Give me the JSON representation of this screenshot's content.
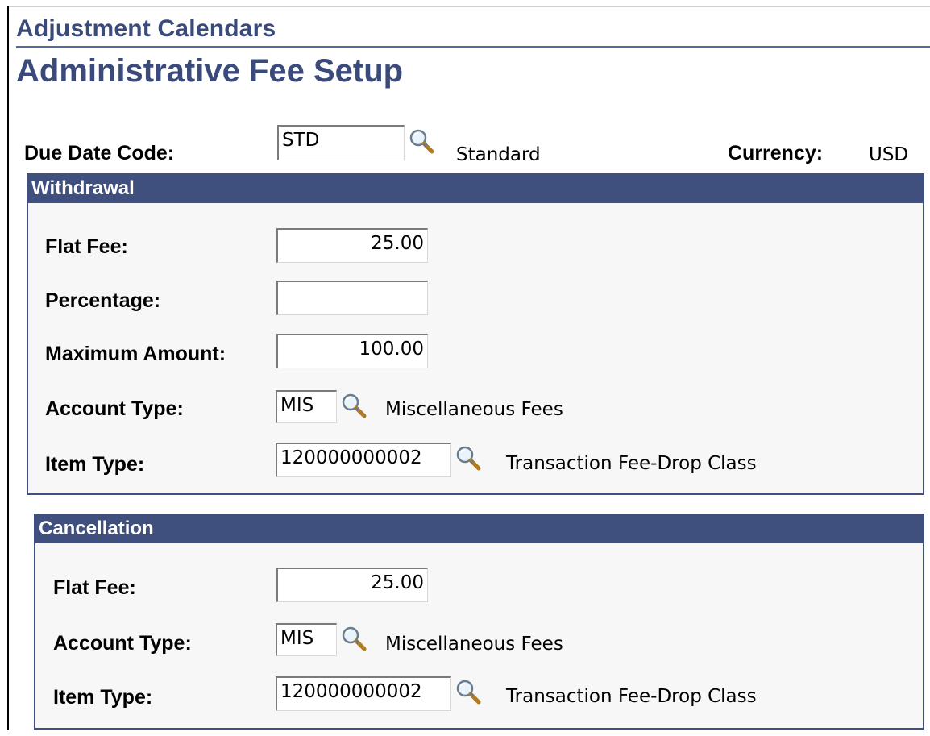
{
  "breadcrumb": "Adjustment Calendars",
  "page_title": "Administrative Fee Setup",
  "header": {
    "due_date_code_label": "Due Date Code:",
    "due_date_code_value": "STD",
    "due_date_code_desc": "Standard",
    "currency_label": "Currency:",
    "currency_value": "USD"
  },
  "withdrawal": {
    "title": "Withdrawal",
    "flat_fee_label": "Flat Fee:",
    "flat_fee_value": "25.00",
    "percentage_label": "Percentage:",
    "percentage_value": "",
    "max_amount_label": "Maximum Amount:",
    "max_amount_value": "100.00",
    "account_type_label": "Account Type:",
    "account_type_value": "MIS",
    "account_type_desc": "Miscellaneous Fees",
    "item_type_label": "Item Type:",
    "item_type_value": "120000000002",
    "item_type_desc": "Transaction Fee-Drop Class"
  },
  "cancellation": {
    "title": "Cancellation",
    "flat_fee_label": "Flat Fee:",
    "flat_fee_value": "25.00",
    "account_type_label": "Account Type:",
    "account_type_value": "MIS",
    "account_type_desc": "Miscellaneous Fees",
    "item_type_label": "Item Type:",
    "item_type_value": "120000000002",
    "item_type_desc": "Transaction Fee-Drop Class"
  },
  "colors": {
    "heading_text": "#3a4a7a",
    "group_header_bg": "#3f4f7e",
    "group_body_bg": "#f7f7f7"
  },
  "icons": {
    "lookup": "magnifying-glass-icon"
  }
}
